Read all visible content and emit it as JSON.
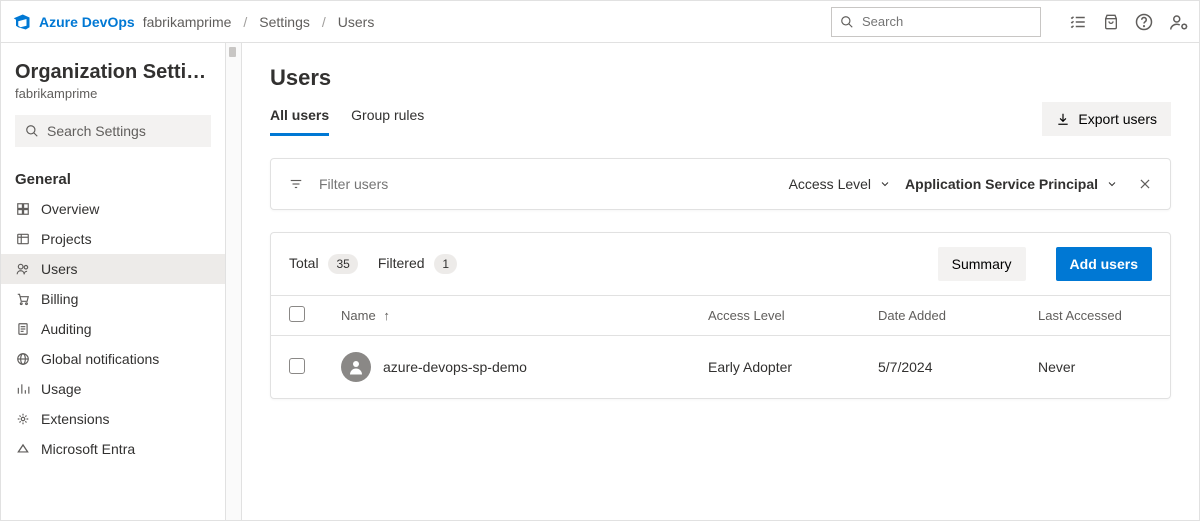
{
  "header": {
    "brand": "Azure DevOps",
    "org": "fabrikamprime",
    "crumbs": [
      "Settings",
      "Users"
    ],
    "search_placeholder": "Search"
  },
  "sidebar": {
    "title": "Organization Settin…",
    "subtitle": "fabrikamprime",
    "search_placeholder": "Search Settings",
    "group_label": "General",
    "items": [
      {
        "label": "Overview"
      },
      {
        "label": "Projects"
      },
      {
        "label": "Users",
        "selected": true
      },
      {
        "label": "Billing"
      },
      {
        "label": "Auditing"
      },
      {
        "label": "Global notifications"
      },
      {
        "label": "Usage"
      },
      {
        "label": "Extensions"
      },
      {
        "label": "Microsoft Entra"
      }
    ]
  },
  "main": {
    "title": "Users",
    "tabs": [
      {
        "label": "All users",
        "active": true
      },
      {
        "label": "Group rules"
      }
    ],
    "export_label": "Export users",
    "filter": {
      "placeholder": "Filter users",
      "level_label": "Access Level",
      "applied_label": "Application Service Principal"
    },
    "counts": {
      "total_label": "Total",
      "total_value": "35",
      "filtered_label": "Filtered",
      "filtered_value": "1"
    },
    "buttons": {
      "summary": "Summary",
      "add": "Add users"
    },
    "columns": {
      "name": "Name",
      "access": "Access Level",
      "added": "Date Added",
      "last": "Last Accessed"
    },
    "rows": [
      {
        "name": "azure-devops-sp-demo",
        "access": "Early Adopter",
        "added": "5/7/2024",
        "last": "Never"
      }
    ]
  }
}
